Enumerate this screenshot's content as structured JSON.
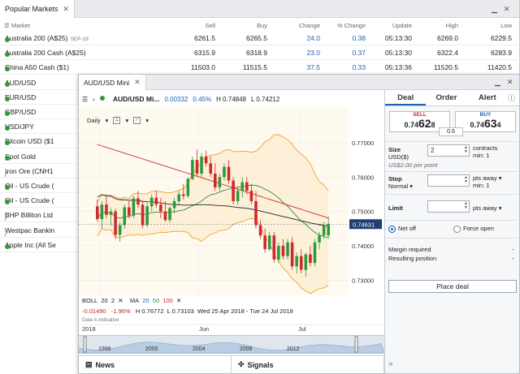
{
  "markets_window": {
    "tab_title": "Popular Markets",
    "columns": [
      "Market",
      "Sell",
      "Buy",
      "Change",
      "% Change",
      "Update",
      "High",
      "Low"
    ],
    "rows": [
      {
        "name": "Australia 200 (A$25)",
        "extra": "SEP-18",
        "sell": "6261.5",
        "buy": "6265.5",
        "change": "24.0",
        "pct": "0.38",
        "update": "05:13:30",
        "high": "6269.0",
        "low": "6229.5",
        "icon": "dot"
      },
      {
        "name": "Australia 200 Cash (A$25)",
        "extra": "",
        "sell": "6315.9",
        "buy": "6318.9",
        "change": "23.0",
        "pct": "0.37",
        "update": "05:13:30",
        "high": "6322.4",
        "low": "6283.9",
        "icon": "dot"
      },
      {
        "name": "China A50 Cash ($1)",
        "extra": "",
        "sell": "11503.0",
        "buy": "11515.5",
        "change": "37.5",
        "pct": "0.33",
        "update": "05:13:36",
        "high": "11520.5",
        "low": "11420.5",
        "icon": "dot"
      },
      {
        "name": "AUD/USD",
        "icon": "dot"
      },
      {
        "name": "EUR/USD",
        "icon": "dot"
      },
      {
        "name": "GBP/USD",
        "icon": "dot"
      },
      {
        "name": "USD/JPY",
        "icon": "dot"
      },
      {
        "name": "Bitcoin USD ($1",
        "icon": "dot"
      },
      {
        "name": "Spot Gold",
        "icon": "dot"
      },
      {
        "name": "Iron Ore (CNH1",
        "icon": "slash"
      },
      {
        "name": "Oil - US Crude (",
        "icon": "dot"
      },
      {
        "name": "Oil - US Crude (",
        "icon": "dot"
      },
      {
        "name": "BHP Billiton Ltd",
        "icon": "slash"
      },
      {
        "name": "Westpac Bankin",
        "icon": "slash"
      },
      {
        "name": "Apple Inc (All Se",
        "icon": "dot"
      }
    ]
  },
  "mini_window": {
    "tab_title": "AUD/USD Mini",
    "symbol": "AUD/USD Mi...",
    "change": "0.00332",
    "change_pct": "0.45%",
    "high": "H 0.74848",
    "low": "L 0.74212",
    "interval": "Daily",
    "indicators": {
      "boll_label": "BOLL",
      "boll_p1": "20",
      "boll_p2": "2",
      "ma_label": "MA",
      "ma1": "20",
      "ma2": "50",
      "ma3": "100",
      "value": "-0.01490",
      "value_pct": "-1.96%",
      "high": "H 0.76772",
      "low": "L 0.73103",
      "range": "Wed 25 Apr 2018 - Tue 24 Jul 2018",
      "note": "Data is indicative"
    },
    "bottom_tabs": [
      "News",
      "Signals"
    ],
    "navigator_years": [
      "1996",
      "2000",
      "2004",
      "2008",
      "2012"
    ]
  },
  "deal_panel": {
    "tabs": [
      "Deal",
      "Order",
      "Alert"
    ],
    "sell_label": "SELL",
    "sell_price_small": "0.74",
    "sell_price_big": "62",
    "sell_price_tail": "8",
    "buy_label": "BUY",
    "buy_price_small": "0.74",
    "buy_price_big": "63",
    "buy_price_tail": "4",
    "spread": "0.6",
    "size_label": "Size",
    "size_unit": "USD($)",
    "size_value": "2",
    "size_suffix": "contracts",
    "size_min": "min: 1",
    "size_note": "US$2.00 per point",
    "stop_label": "Stop",
    "stop_type": "Normal",
    "stop_suffix": "pts away",
    "stop_min": "min: 1",
    "limit_label": "Limit",
    "limit_suffix": "pts away",
    "net_off": "Net off",
    "force_open": "Force open",
    "margin_label": "Margin required",
    "margin_value": "-",
    "position_label": "Resulting position",
    "position_value": "-",
    "place_deal": "Place deal"
  },
  "chart_data": {
    "type": "candlestick",
    "y_ticks": [
      "0.77000",
      "0.76000",
      "0.75000",
      "0.74000",
      "0.73000"
    ],
    "ylim": [
      0.727,
      0.7785
    ],
    "x_labels": [
      "2018",
      "Jun",
      "Jul"
    ],
    "last_price": "0.74631",
    "candles": [
      [
        0.7515,
        0.7535,
        0.747,
        0.7478
      ],
      [
        0.7478,
        0.753,
        0.745,
        0.752
      ],
      [
        0.752,
        0.755,
        0.748,
        0.749
      ],
      [
        0.749,
        0.751,
        0.746,
        0.75
      ],
      [
        0.75,
        0.7508,
        0.742,
        0.7432
      ],
      [
        0.7432,
        0.747,
        0.7412,
        0.746
      ],
      [
        0.746,
        0.752,
        0.745,
        0.7512
      ],
      [
        0.7512,
        0.753,
        0.748,
        0.7488
      ],
      [
        0.7488,
        0.7545,
        0.748,
        0.7538
      ],
      [
        0.7538,
        0.756,
        0.751,
        0.752
      ],
      [
        0.752,
        0.753,
        0.745,
        0.746
      ],
      [
        0.746,
        0.7525,
        0.7455,
        0.7515
      ],
      [
        0.7515,
        0.755,
        0.75,
        0.754
      ],
      [
        0.754,
        0.756,
        0.751,
        0.752
      ],
      [
        0.752,
        0.754,
        0.748,
        0.75
      ],
      [
        0.75,
        0.753,
        0.747,
        0.7475
      ],
      [
        0.7475,
        0.7515,
        0.7468,
        0.751
      ],
      [
        0.751,
        0.754,
        0.7495,
        0.753
      ],
      [
        0.753,
        0.756,
        0.752,
        0.755
      ],
      [
        0.755,
        0.758,
        0.7535,
        0.7545
      ],
      [
        0.7545,
        0.76,
        0.754,
        0.7595
      ],
      [
        0.7595,
        0.766,
        0.759,
        0.765
      ],
      [
        0.765,
        0.768,
        0.76,
        0.761
      ],
      [
        0.761,
        0.767,
        0.76,
        0.766
      ],
      [
        0.766,
        0.7677,
        0.763,
        0.764
      ],
      [
        0.764,
        0.766,
        0.76,
        0.761
      ],
      [
        0.761,
        0.764,
        0.756,
        0.757
      ],
      [
        0.757,
        0.761,
        0.756,
        0.76
      ],
      [
        0.76,
        0.764,
        0.759,
        0.763
      ],
      [
        0.763,
        0.765,
        0.758,
        0.759
      ],
      [
        0.759,
        0.76,
        0.752,
        0.753
      ],
      [
        0.753,
        0.757,
        0.752,
        0.756
      ],
      [
        0.756,
        0.76,
        0.754,
        0.7585
      ],
      [
        0.7585,
        0.76,
        0.755,
        0.756
      ],
      [
        0.756,
        0.758,
        0.752,
        0.753
      ],
      [
        0.753,
        0.756,
        0.745,
        0.746
      ],
      [
        0.746,
        0.7475,
        0.742,
        0.743
      ],
      [
        0.743,
        0.745,
        0.738,
        0.739
      ],
      [
        0.739,
        0.744,
        0.7385,
        0.743
      ],
      [
        0.743,
        0.744,
        0.735,
        0.736
      ],
      [
        0.736,
        0.741,
        0.735,
        0.74
      ],
      [
        0.74,
        0.742,
        0.736,
        0.737
      ],
      [
        0.737,
        0.742,
        0.736,
        0.741
      ],
      [
        0.741,
        0.7425,
        0.733,
        0.734
      ],
      [
        0.734,
        0.738,
        0.732,
        0.737
      ],
      [
        0.737,
        0.739,
        0.732,
        0.733
      ],
      [
        0.733,
        0.738,
        0.731,
        0.7375
      ],
      [
        0.7375,
        0.74,
        0.734,
        0.735
      ],
      [
        0.735,
        0.742,
        0.734,
        0.741
      ],
      [
        0.741,
        0.744,
        0.739,
        0.743
      ],
      [
        0.743,
        0.747,
        0.742,
        0.746
      ],
      [
        0.743,
        0.7485,
        0.7421,
        0.7463
      ]
    ]
  }
}
